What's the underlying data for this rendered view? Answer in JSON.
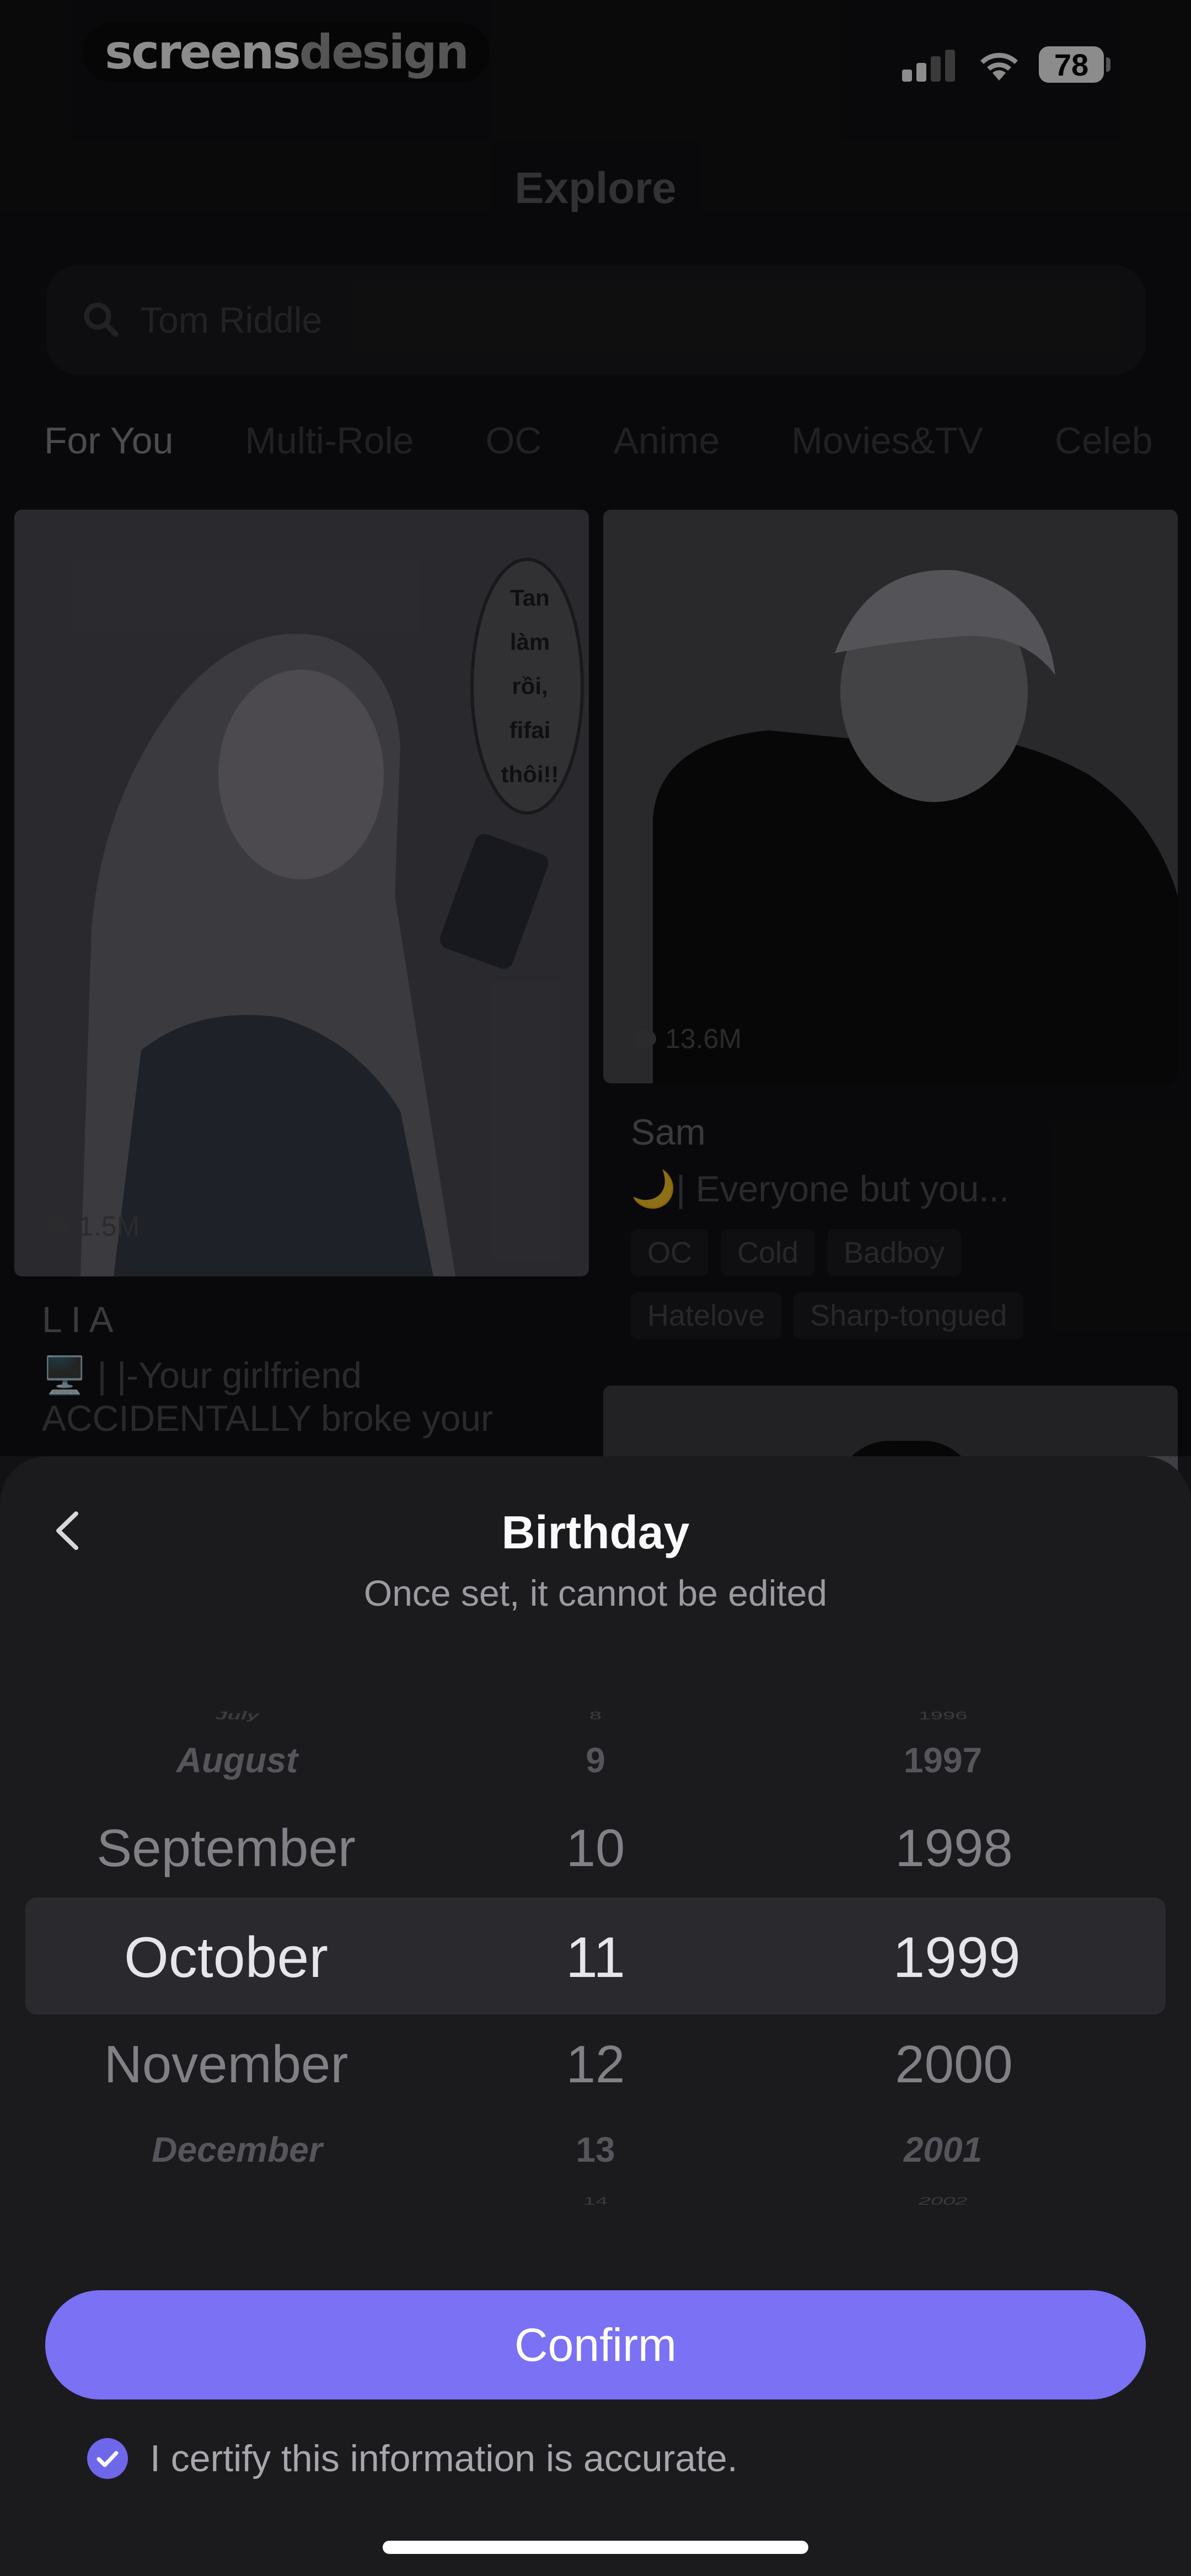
{
  "watermark": {
    "part1": "screens",
    "part2": "design"
  },
  "status_bar": {
    "battery": "78"
  },
  "header": {
    "title": "Explore"
  },
  "search": {
    "placeholder": "Tom Riddle"
  },
  "tabs": [
    "For You",
    "Multi-Role",
    "OC",
    "Anime",
    "Movies&TV",
    "Celeb"
  ],
  "cards": [
    {
      "name": "L I A",
      "count": "1.5M",
      "bubble_text": [
        "Tan",
        "làm",
        "rồi,",
        "fifai",
        "thôi!!"
      ],
      "description_line1": "🖥️ | |-Your girlfriend",
      "description_line2": "ACCIDENTALLY broke your"
    },
    {
      "name": "Sam",
      "count": "13.6M",
      "description": "🌙| Everyone but you...",
      "tags": [
        "OC",
        "Cold",
        "Badboy",
        "Hatelove",
        "Sharp-tongued"
      ]
    }
  ],
  "sheet": {
    "title": "Birthday",
    "subtitle": "Once set, it cannot be edited",
    "picker": {
      "months": [
        "July",
        "August",
        "September",
        "October",
        "November",
        "December"
      ],
      "days": [
        "8",
        "9",
        "10",
        "11",
        "12",
        "13",
        "14"
      ],
      "years": [
        "1996",
        "1997",
        "1998",
        "1999",
        "2000",
        "2001",
        "2002"
      ],
      "selected": {
        "month": "October",
        "day": "11",
        "year": "1999"
      }
    },
    "confirm_label": "Confirm",
    "certify_text": "I certify this information is accurate.",
    "certify_checked": true
  },
  "colors": {
    "accent": "#7a71f4",
    "sheet_bg": "#1b1b1e"
  }
}
